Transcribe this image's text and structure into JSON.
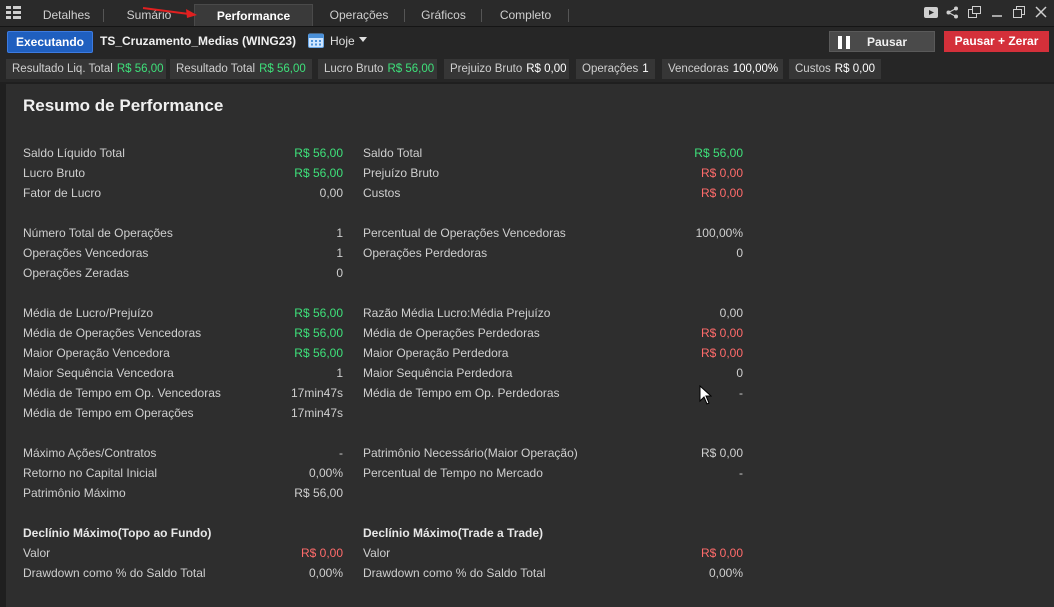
{
  "tabs": [
    {
      "label": "Detalhes"
    },
    {
      "label": "Sumário"
    },
    {
      "label": "Performance"
    },
    {
      "label": "Operações"
    },
    {
      "label": "Gráficos"
    },
    {
      "label": "Completo"
    }
  ],
  "toolbar": {
    "status_label": "Executando",
    "strategy": "TS_Cruzamento_Medias (WING23)",
    "date_label": "Hoje",
    "pause_label": "Pausar",
    "pause_zero_label": "Pausar + Zerar"
  },
  "stats": [
    {
      "label": "Resultado Liq. Total",
      "value": "R$ 56,00",
      "color": "green"
    },
    {
      "label": "Resultado Total",
      "value": "R$ 56,00",
      "color": "green"
    },
    {
      "label": "Lucro Bruto",
      "value": "R$ 56,00",
      "color": "green"
    },
    {
      "label": "Prejuizo Bruto",
      "value": "R$ 0,00",
      "color": "white"
    },
    {
      "label": "Operações",
      "value": "1",
      "color": "white"
    },
    {
      "label": "Vencedoras",
      "value": "100,00%",
      "color": "white"
    },
    {
      "label": "Custos",
      "value": "R$ 0,00",
      "color": "white"
    }
  ],
  "title": "Resumo de Performance",
  "rows": [
    {
      "l": "Saldo Líquido Total",
      "lv": "R$ 56,00",
      "lc": "green",
      "r": "Saldo Total",
      "rv": "R$ 56,00",
      "rc": "green"
    },
    {
      "l": "Lucro Bruto",
      "lv": "R$ 56,00",
      "lc": "green",
      "r": "Prejuízo Bruto",
      "rv": "R$ 0,00",
      "rc": "red"
    },
    {
      "l": "Fator de Lucro",
      "lv": "0,00",
      "lc": "",
      "r": "Custos",
      "rv": "R$ 0,00",
      "rc": "red"
    },
    {
      "l": "Número Total de Operações",
      "lv": "1",
      "lc": "",
      "r": "Percentual de Operações Vencedoras",
      "rv": "100,00%",
      "rc": ""
    },
    {
      "l": "Operações Vencedoras",
      "lv": "1",
      "lc": "",
      "r": "Operações Perdedoras",
      "rv": "0",
      "rc": ""
    },
    {
      "l": "Operações Zeradas",
      "lv": "0",
      "lc": "",
      "r": "",
      "rv": "",
      "rc": ""
    },
    {
      "l": "Média de Lucro/Prejuízo",
      "lv": "R$ 56,00",
      "lc": "green",
      "r": "Razão Média Lucro:Média Prejuízo",
      "rv": "0,00",
      "rc": ""
    },
    {
      "l": "Média de Operações Vencedoras",
      "lv": "R$ 56,00",
      "lc": "green",
      "r": "Média de Operações Perdedoras",
      "rv": "R$ 0,00",
      "rc": "red"
    },
    {
      "l": "Maior Operação Vencedora",
      "lv": "R$ 56,00",
      "lc": "green",
      "r": "Maior Operação Perdedora",
      "rv": "R$ 0,00",
      "rc": "red"
    },
    {
      "l": "Maior Sequência Vencedora",
      "lv": "1",
      "lc": "",
      "r": "Maior Sequência Perdedora",
      "rv": "0",
      "rc": ""
    },
    {
      "l": "Média de Tempo em Op. Vencedoras",
      "lv": "17min47s",
      "lc": "",
      "r": "Média de Tempo em Op. Perdedoras",
      "rv": "-",
      "rc": ""
    },
    {
      "l": "Média de Tempo em Operações",
      "lv": "17min47s",
      "lc": "",
      "r": "",
      "rv": "",
      "rc": ""
    },
    {
      "l": "Máximo Ações/Contratos",
      "lv": "-",
      "lc": "",
      "r": "Patrimônio Necessário(Maior Operação)",
      "rv": "R$ 0,00",
      "rc": ""
    },
    {
      "l": "Retorno no Capital Inicial",
      "lv": "0,00%",
      "lc": "",
      "r": "Percentual de Tempo no Mercado",
      "rv": "-",
      "rc": ""
    },
    {
      "l": "Patrimônio Máximo",
      "lv": "R$ 56,00",
      "lc": "",
      "r": "",
      "rv": "",
      "rc": ""
    },
    {
      "l": "Declínio Máximo(Topo ao Fundo)",
      "lv": "",
      "lc": "",
      "r": "Declínio Máximo(Trade a Trade)",
      "rv": "",
      "rc": "",
      "header": true
    },
    {
      "l": "Valor",
      "lv": "R$ 0,00",
      "lc": "red",
      "r": "Valor",
      "rv": "R$ 0,00",
      "rc": "red"
    },
    {
      "l": "Drawdown como % do Saldo Total",
      "lv": "0,00%",
      "lc": "",
      "r": "Drawdown como % do Saldo Total",
      "rv": "0,00%",
      "rc": ""
    }
  ],
  "colors": {
    "green": "#3ee07a",
    "red": "#ff6b6b",
    "accent": "#1f5fbf",
    "danger": "#d4303a"
  },
  "icons": [
    "menu-icon",
    "youtube-icon",
    "share-icon",
    "popout-icon",
    "minimize-icon",
    "restore-icon",
    "close-icon",
    "calendar-icon",
    "chevron-down-icon",
    "pause-icon"
  ]
}
